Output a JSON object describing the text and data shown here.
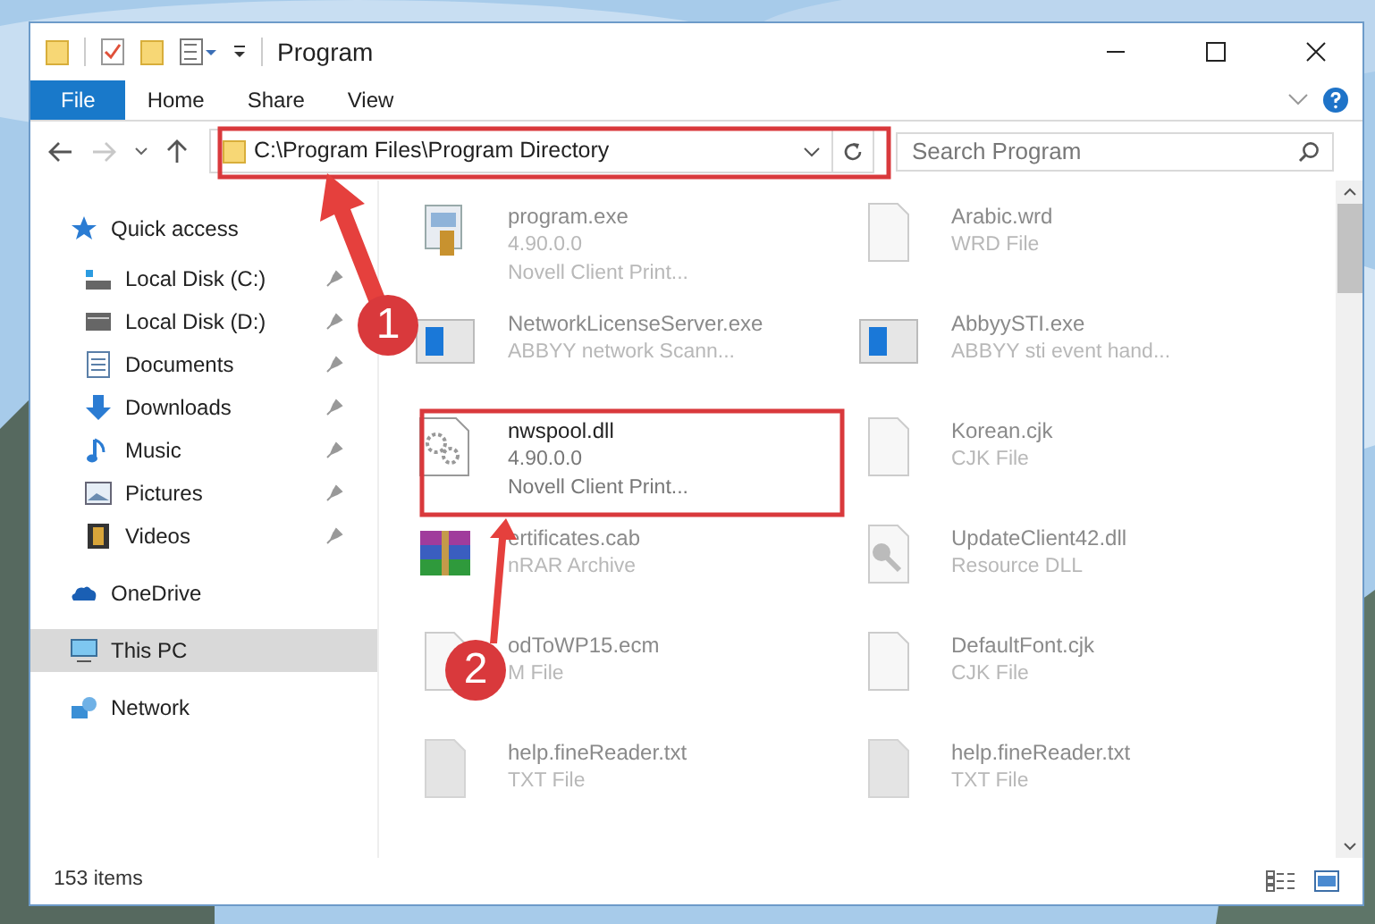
{
  "window": {
    "title": "Program"
  },
  "ribbon_tabs": [
    {
      "label": "File",
      "selected": true
    },
    {
      "label": "Home",
      "selected": false
    },
    {
      "label": "Share",
      "selected": false
    },
    {
      "label": "View",
      "selected": false
    }
  ],
  "address_bar": {
    "path": "C:\\Program Files\\Program Directory"
  },
  "search": {
    "placeholder": "Search Program"
  },
  "sidebar": {
    "items": [
      {
        "label": "Quick access",
        "kind": "star",
        "pinned": false,
        "selected": false,
        "group": true
      },
      {
        "label": "Local Disk (C:)",
        "kind": "disk-c",
        "pinned": true,
        "selected": false,
        "group": false
      },
      {
        "label": "Local Disk (D:)",
        "kind": "disk",
        "pinned": true,
        "selected": false,
        "group": false
      },
      {
        "label": "Documents",
        "kind": "documents",
        "pinned": true,
        "selected": false,
        "group": false
      },
      {
        "label": "Downloads",
        "kind": "downloads",
        "pinned": true,
        "selected": false,
        "group": false
      },
      {
        "label": "Music",
        "kind": "music",
        "pinned": true,
        "selected": false,
        "group": false
      },
      {
        "label": "Pictures",
        "kind": "pictures",
        "pinned": true,
        "selected": false,
        "group": false
      },
      {
        "label": "Videos",
        "kind": "videos",
        "pinned": true,
        "selected": false,
        "group": false
      },
      {
        "label": "OneDrive",
        "kind": "cloud",
        "pinned": false,
        "selected": false,
        "group": true
      },
      {
        "label": "This PC",
        "kind": "pc",
        "pinned": false,
        "selected": true,
        "group": true
      },
      {
        "label": "Network",
        "kind": "network",
        "pinned": false,
        "selected": false,
        "group": true
      }
    ]
  },
  "files": [
    {
      "name": "program.exe",
      "lines": [
        "4.90.0.0",
        "Novell Client Print..."
      ],
      "kind": "setup",
      "highlighted": false
    },
    {
      "name": "Arabic.wrd",
      "lines": [
        "WRD File"
      ],
      "kind": "blank",
      "highlighted": false
    },
    {
      "name": "NetworkLicenseServer.exe",
      "lines": [
        "ABBYY network Scann..."
      ],
      "kind": "window",
      "highlighted": false
    },
    {
      "name": "AbbyySTI.exe",
      "lines": [
        "ABBYY sti event hand..."
      ],
      "kind": "window",
      "highlighted": false
    },
    {
      "name": "nwspool.dll",
      "lines": [
        "4.90.0.0",
        "Novell Client Print..."
      ],
      "kind": "gear",
      "highlighted": true
    },
    {
      "name": "Korean.cjk",
      "lines": [
        "CJK File"
      ],
      "kind": "blank",
      "highlighted": false
    },
    {
      "name": "ertificates.cab",
      "lines": [
        "nRAR Archive"
      ],
      "kind": "archive",
      "highlighted": false
    },
    {
      "name": "UpdateClient42.dll",
      "lines": [
        "Resource DLL"
      ],
      "kind": "key",
      "highlighted": false
    },
    {
      "name": "odToWP15.ecm",
      "lines": [
        "M File"
      ],
      "kind": "blank",
      "highlighted": false
    },
    {
      "name": "DefaultFont.cjk",
      "lines": [
        "CJK File"
      ],
      "kind": "blank",
      "highlighted": false
    },
    {
      "name": "help.fineReader.txt",
      "lines": [
        "TXT File"
      ],
      "kind": "text",
      "highlighted": false
    },
    {
      "name": "help.fineReader.txt",
      "lines": [
        "TXT File"
      ],
      "kind": "text",
      "highlighted": false
    }
  ],
  "status_bar": {
    "item_count": "153 items"
  },
  "callouts": [
    {
      "label": "1"
    },
    {
      "label": "2"
    }
  ]
}
